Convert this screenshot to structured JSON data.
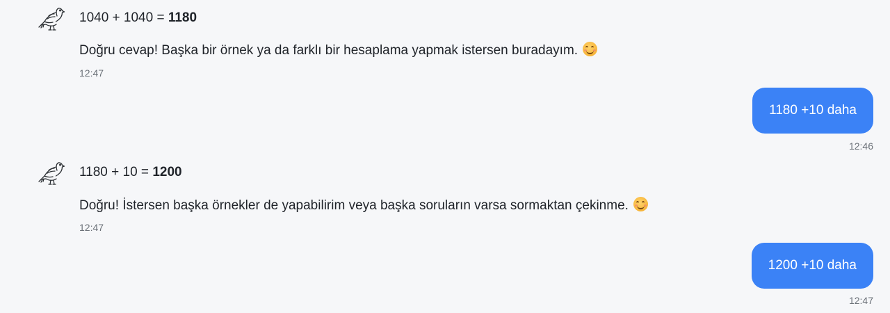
{
  "messages": [
    {
      "role": "bot",
      "avatar_icon": "pigeon-icon",
      "equation_prefix": "1040 + 1040 = ",
      "equation_result": "1180",
      "text": "Doğru cevap! Başka bir örnek ya da farklı bir hesaplama yapmak istersen buradayım.",
      "emoji": "smiling-face-icon",
      "time": "12:47"
    },
    {
      "role": "user",
      "text": "1180 +10 daha",
      "time": "12:46"
    },
    {
      "role": "bot",
      "avatar_icon": "pigeon-icon",
      "equation_prefix": "1180 + 10 = ",
      "equation_result": "1200",
      "text": "Doğru! İstersen başka örnekler de yapabilirim veya başka soruların varsa sormaktan çekinme.",
      "emoji": "smiling-face-icon",
      "time": "12:47"
    },
    {
      "role": "user",
      "text": "1200 +10 daha",
      "time": "12:47"
    }
  ],
  "colors": {
    "background": "#f6f7f9",
    "user_bubble": "#3b82f6",
    "timestamp": "#6b7178"
  }
}
